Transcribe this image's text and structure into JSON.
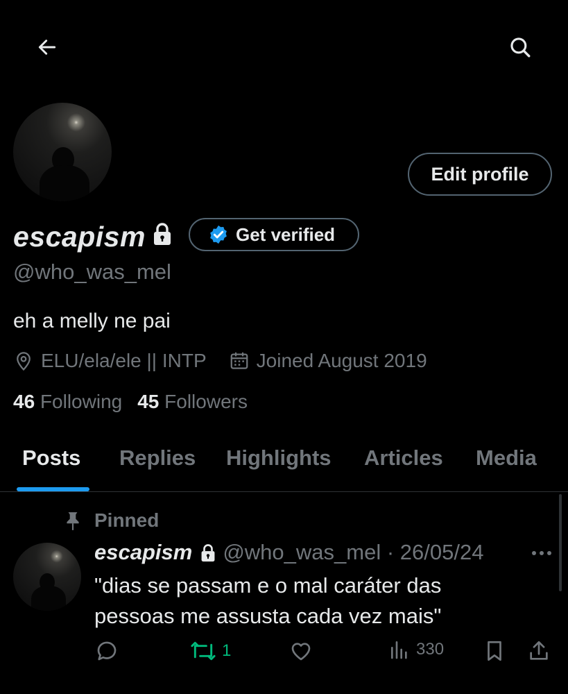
{
  "header": {
    "back_icon": "arrow-left-icon",
    "search_icon": "search-icon"
  },
  "profile": {
    "display_name": "escapism",
    "handle": "@who_was_mel",
    "bio": "eh a melly ne pai",
    "location": "ELU/ela/ele || INTP",
    "joined": "Joined August 2019",
    "following_count": "46",
    "following_label": "Following",
    "followers_count": "45",
    "followers_label": "Followers",
    "edit_profile_label": "Edit profile",
    "get_verified_label": "Get verified"
  },
  "tabs": [
    {
      "label": "Posts",
      "active": true
    },
    {
      "label": "Replies"
    },
    {
      "label": "Highlights"
    },
    {
      "label": "Articles"
    },
    {
      "label": "Media"
    }
  ],
  "pinned_post": {
    "pinned_label": "Pinned",
    "author_name": "escapism",
    "meta": "@who_was_mel · 26/05/24",
    "text": "\"dias se passam e o mal caráter das pessoas me assusta cada vez mais\"",
    "retweets": "1",
    "views": "330"
  },
  "colors": {
    "background": "#000000",
    "text_primary": "#e7e9ea",
    "text_secondary": "#71767b",
    "accent": "#1d9bf0",
    "retweet_green": "#00ba7c",
    "border": "#536471"
  }
}
